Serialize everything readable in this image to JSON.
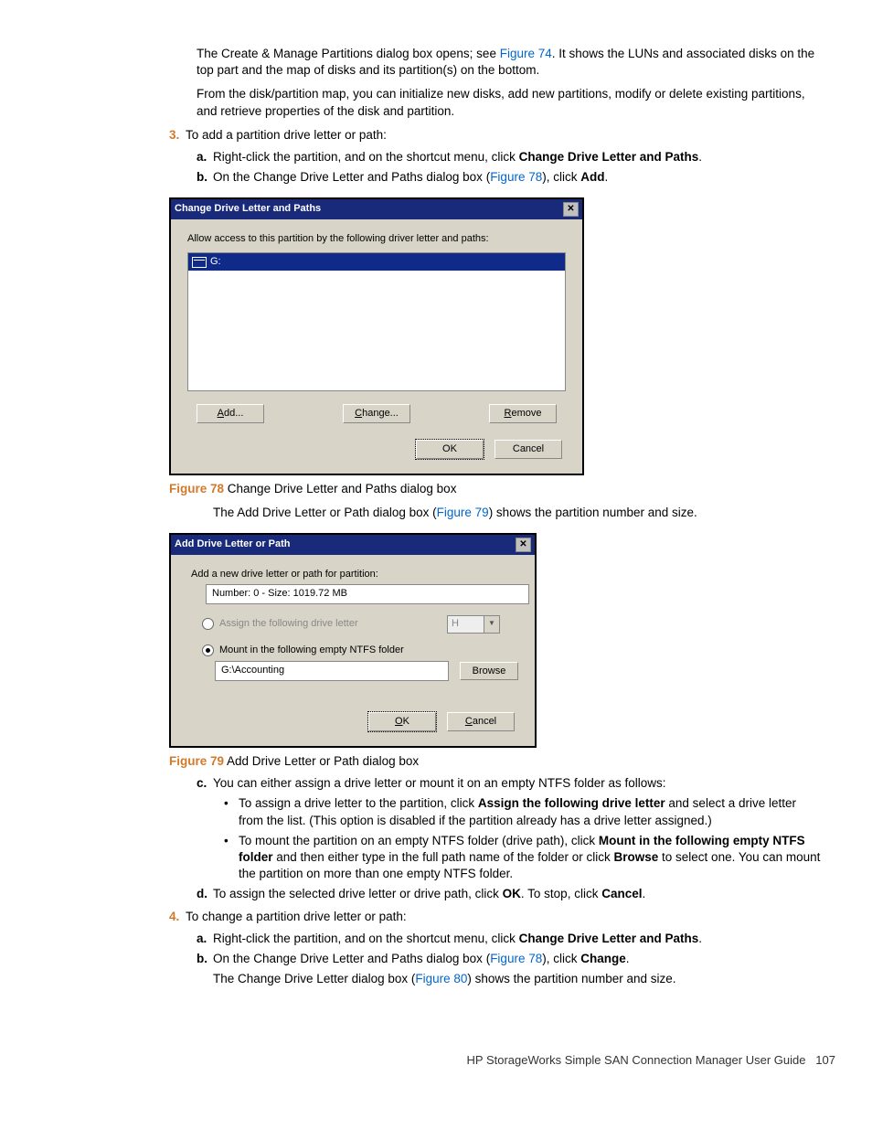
{
  "intro": {
    "p1a": "The Create & Manage Partitions dialog box opens; see ",
    "p1_link": "Figure 74",
    "p1b": ". It shows the LUNs and associated disks on the top part and the map of disks and its partition(s) on the bottom.",
    "p2": "From the disk/partition map, you can initialize new disks, add new partitions, modify or delete existing partitions, and retrieve properties of the disk and partition."
  },
  "step3": {
    "num": "3.",
    "text": "To add a partition drive letter or path:",
    "a": {
      "letter": "a.",
      "text_a": "Right-click the partition, and on the shortcut menu, click ",
      "bold": "Change Drive Letter and Paths",
      "text_b": "."
    },
    "b": {
      "letter": "b.",
      "text_a": "On the Change Drive Letter and Paths dialog box (",
      "link": "Figure 78",
      "text_b": "), click ",
      "bold": "Add",
      "text_c": "."
    }
  },
  "dialog1": {
    "title": "Change Drive Letter and Paths",
    "prompt": "Allow access to this partition by the following driver letter and paths:",
    "selected": "G:",
    "add": "Add...",
    "change": "Change...",
    "remove": "Remove",
    "ok": "OK",
    "cancel": "Cancel"
  },
  "caption1": {
    "label": "Figure 78",
    "text": "  Change Drive Letter and Paths dialog box"
  },
  "mid": {
    "text_a": "The Add Drive Letter or Path dialog box (",
    "link": "Figure 79",
    "text_b": ") shows the partition number and size."
  },
  "dialog2": {
    "title": "Add Drive Letter or Path",
    "prompt": "Add a new drive letter or path for partition:",
    "info": "Number: 0 - Size: 1019.72 MB",
    "opt1": "Assign the following drive letter",
    "combo": "H",
    "opt2": "Mount in the following empty NTFS folder",
    "path": "G:\\Accounting",
    "browse": "Browse",
    "ok": "OK",
    "cancel": "Cancel"
  },
  "caption2": {
    "label": "Figure 79",
    "text": "  Add Drive Letter or Path dialog box"
  },
  "step3c": {
    "letter": "c.",
    "text": "You can either assign a drive letter or mount it on an empty NTFS folder as follows:",
    "b1_a": "To assign a drive letter to the partition, click ",
    "b1_bold": "Assign the following drive letter",
    "b1_b": " and select a drive letter from the list. (This option is disabled if the partition already has a drive letter assigned.)",
    "b2_a": "To mount the partition on an empty NTFS folder (drive path), click ",
    "b2_bold": "Mount in the following empty NTFS folder",
    "b2_b": " and then either type in the full path name of the folder or click ",
    "b2_bold2": "Browse",
    "b2_c": " to select one. You can mount the partition on more than one empty NTFS folder."
  },
  "step3d": {
    "letter": "d.",
    "a": "To assign the selected drive letter or drive path, click ",
    "b1": "OK",
    "b": ". To stop, click ",
    "b2": "Cancel",
    "c": "."
  },
  "step4": {
    "num": "4.",
    "text": "To change a partition drive letter or path:",
    "a": {
      "letter": "a.",
      "text_a": "Right-click the partition, and on the shortcut menu, click ",
      "bold": "Change Drive Letter and Paths",
      "text_b": "."
    },
    "b": {
      "letter": "b.",
      "text_a": "On the Change Drive Letter and Paths dialog box (",
      "link": "Figure 78",
      "text_b": "), click ",
      "bold": "Change",
      "text_c": "."
    },
    "tail_a": "The Change Drive Letter dialog box (",
    "tail_link": "Figure 80",
    "tail_b": ") shows the partition number and size."
  },
  "footer": {
    "text": "HP StorageWorks Simple SAN Connection Manager User Guide",
    "page": "107"
  }
}
